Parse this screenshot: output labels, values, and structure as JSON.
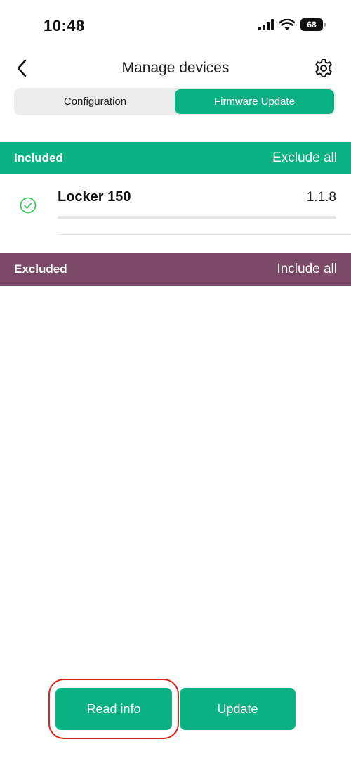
{
  "status_bar": {
    "time": "10:48",
    "battery": "68",
    "icons": [
      "signal-icon",
      "wifi-icon",
      "battery-icon"
    ]
  },
  "nav": {
    "title": "Manage devices",
    "back_icon": "chevron-left-icon",
    "settings_icon": "gear-icon"
  },
  "tabs": [
    {
      "label": "Configuration",
      "active": false
    },
    {
      "label": "Firmware Update",
      "active": true
    }
  ],
  "included": {
    "label": "Included",
    "action": "Exclude all",
    "color": "#0ab283",
    "devices": [
      {
        "name": "Locker 150",
        "version": "1.1.8",
        "progress": 0,
        "status_icon": "check-circle-icon"
      }
    ]
  },
  "excluded": {
    "label": "Excluded",
    "action": "Include all",
    "color": "#7a4a68",
    "devices": []
  },
  "buttons": {
    "read_info": "Read info",
    "update": "Update"
  },
  "colors": {
    "accent": "#0ab283",
    "excluded": "#7a4a68",
    "highlight": "#d9231c"
  }
}
